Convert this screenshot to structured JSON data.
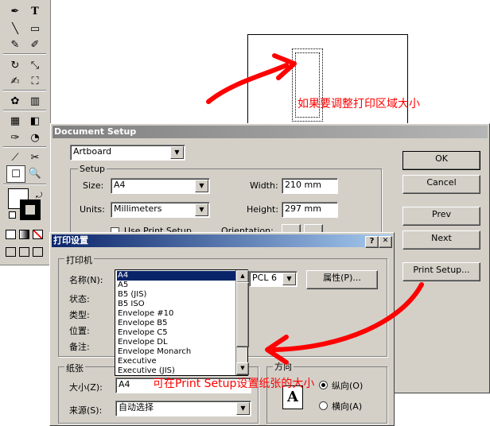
{
  "toolbox": {
    "tools": [
      "pen-tool",
      "type-tool",
      "line-tool",
      "rectangle-tool",
      "pencil-tool",
      "brush-tool",
      "rotate-tool",
      "scale-tool",
      "reshape-tool",
      "free-transform-tool",
      "symbol-tool",
      "graph-tool",
      "mesh-tool",
      "gradient-tool",
      "eyedropper-tool",
      "blend-tool",
      "slice-tool",
      "scissors-tool",
      "hand-tool",
      "zoom-tool"
    ],
    "type_glyph": "T"
  },
  "annotations": {
    "top": "如果要调整打印区域大小",
    "bottom": "可在Print Setup设置纸张的大小"
  },
  "doc_setup": {
    "title": "Document Setup",
    "top_dropdown": "Artboard",
    "setup_group": "Setup",
    "size_label": "Size:",
    "size_value": "A4",
    "units_label": "Units:",
    "units_value": "Millimeters",
    "width_label": "Width:",
    "width_value": "210 mm",
    "height_label": "Height:",
    "height_value": "297 mm",
    "use_print_setup": "Use Print Setup",
    "orientation_label": "Orientation:",
    "buttons": {
      "ok": "OK",
      "cancel": "Cancel",
      "prev": "Prev",
      "next": "Next",
      "print_setup": "Print Setup..."
    }
  },
  "print_dialog": {
    "title": "打印设置",
    "help": "?",
    "close": "✕",
    "printer_group": "打印机",
    "name_label": "名称(N):",
    "status_label": "状态:",
    "type_label": "类型:",
    "where_label": "位置:",
    "comment_label": "备注:",
    "printer_value": "PCL 6",
    "properties_button": "属性(P)...",
    "paper_group": "纸张",
    "size_label": "大小(Z):",
    "size_value": "A4",
    "source_label": "来源(S):",
    "source_value": "自动选择",
    "orientation_group": "方向",
    "portrait_label": "纵向(O)",
    "landscape_label": "横向(A)",
    "orientation_icon": "A",
    "paper_list": [
      "A4",
      "A5",
      "B5 (JIS)",
      "B5 ISO",
      "Envelope #10",
      "Envelope B5",
      "Envelope C5",
      "Envelope DL",
      "Envelope Monarch",
      "Executive",
      "Executive (JIS)"
    ]
  },
  "colors": {
    "accent_red": "#ff0000",
    "title_bar": "#808080",
    "active_title": "#0a246a",
    "selection": "#0a246a"
  }
}
